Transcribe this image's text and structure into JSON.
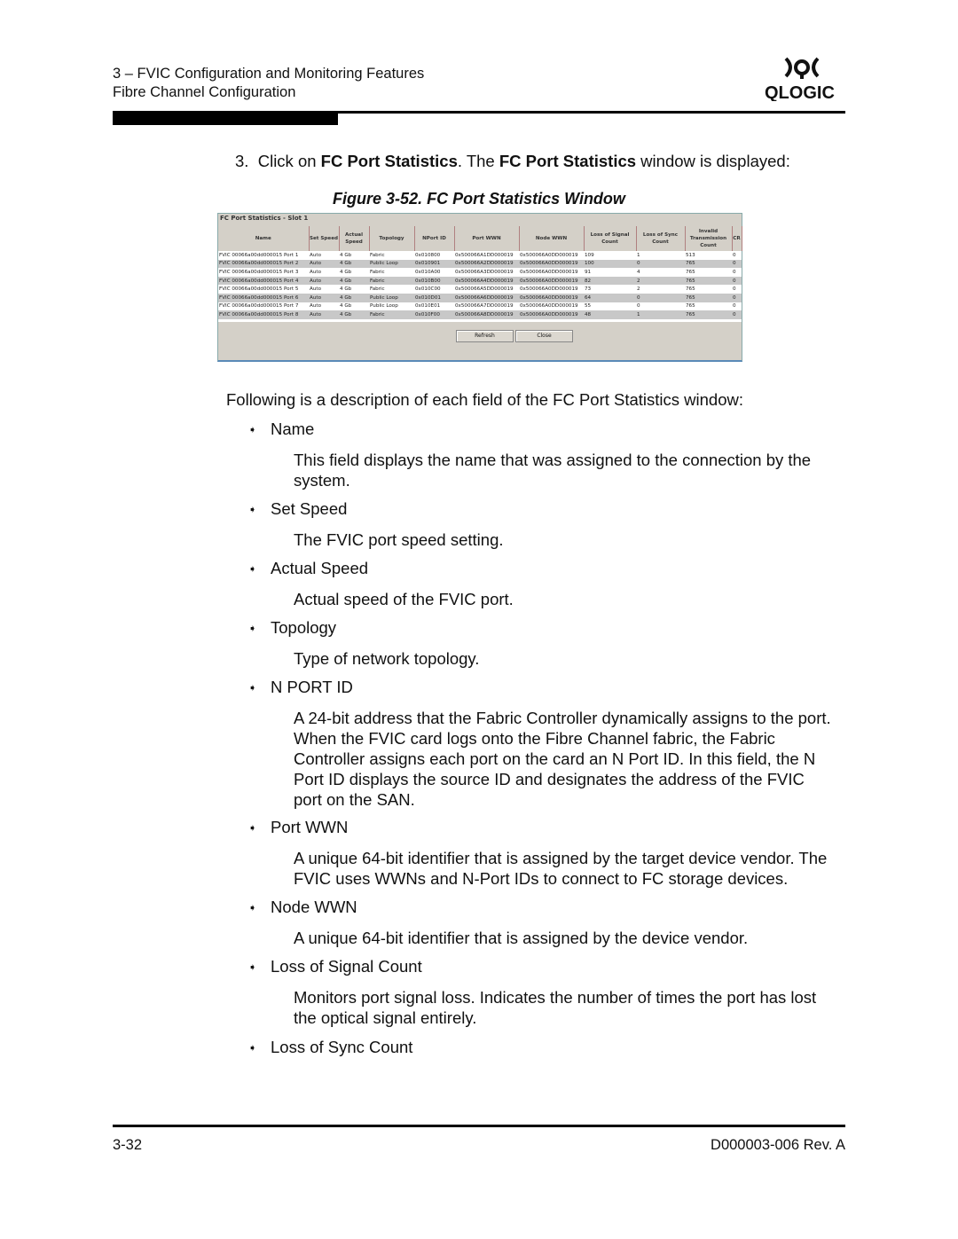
{
  "header": {
    "chapter": "3 – FVIC Configuration and Monitoring Features",
    "section": "Fibre Channel Configuration",
    "logo_text": "QLOGIC"
  },
  "intro": {
    "num": "3.",
    "pre": "Click on ",
    "b1": "FC Port Statistics",
    "mid": ". The ",
    "b2": "FC Port Statistics",
    "post": " window is displayed:"
  },
  "figure_caption": "Figure 3-52. FC Port Statistics Window",
  "window": {
    "title": "FC Port Statistics - Slot 1",
    "columns": [
      "Name",
      "Set Speed",
      "Actual Speed",
      "Topology",
      "NPort ID",
      "Port WWN",
      "Node WWN",
      "Loss of Signal Count",
      "Loss of Sync Count",
      "Invalid Transmission Count",
      "CR"
    ],
    "rows": [
      [
        "FVIC 00066a00dd000015 Port 1",
        "Auto",
        "4 Gb",
        "Fabric",
        "0x010800",
        "0x500066A1DD000019",
        "0x500066A0DD000019",
        "109",
        "1",
        "513",
        "0"
      ],
      [
        "FVIC 00066a00dd000015 Port 2",
        "Auto",
        "4 Gb",
        "Public Loop",
        "0x010901",
        "0x500066A2DD000019",
        "0x500066A0DD000019",
        "100",
        "0",
        "765",
        "0"
      ],
      [
        "FVIC 00066a00dd000015 Port 3",
        "Auto",
        "4 Gb",
        "Fabric",
        "0x010A00",
        "0x500066A3DD000019",
        "0x500066A0DD000019",
        "91",
        "4",
        "765",
        "0"
      ],
      [
        "FVIC 00066a00dd000015 Port 4",
        "Auto",
        "4 Gb",
        "Fabric",
        "0x010B00",
        "0x500066A4DD000019",
        "0x500066A0DD000019",
        "82",
        "2",
        "765",
        "0"
      ],
      [
        "FVIC 00066a00dd000015 Port 5",
        "Auto",
        "4 Gb",
        "Fabric",
        "0x010C00",
        "0x500066A5DD000019",
        "0x500066A0DD000019",
        "73",
        "2",
        "765",
        "0"
      ],
      [
        "FVIC 00066a00dd000015 Port 6",
        "Auto",
        "4 Gb",
        "Public Loop",
        "0x010D01",
        "0x500066A6DD000019",
        "0x500066A0DD000019",
        "64",
        "0",
        "765",
        "0"
      ],
      [
        "FVIC 00066a00dd000015 Port 7",
        "Auto",
        "4 Gb",
        "Public Loop",
        "0x010E01",
        "0x500066A7DD000019",
        "0x500066A0DD000019",
        "55",
        "0",
        "765",
        "0"
      ],
      [
        "FVIC 00066a00dd000015 Port 8",
        "Auto",
        "4 Gb",
        "Fabric",
        "0x010F00",
        "0x500066A8DD000019",
        "0x500066A0DD000019",
        "48",
        "1",
        "765",
        "0"
      ]
    ],
    "refresh_label": "Refresh",
    "close_label": "Close"
  },
  "following": "Following is a description of each field of the FC Port Statistics window:",
  "fields": [
    {
      "label": "Name",
      "desc": [
        "This field displays the name that was assigned to the connection by the",
        "system."
      ]
    },
    {
      "label": "Set Speed",
      "desc": [
        "The FVIC port speed setting."
      ]
    },
    {
      "label": "Actual Speed",
      "desc": [
        "Actual speed of the FVIC port."
      ]
    },
    {
      "label": "Topology",
      "desc": [
        "Type of network topology."
      ]
    },
    {
      "label": "N PORT ID",
      "desc": [
        "A 24-bit address that the Fabric Controller dynamically assigns to the port.",
        "When the FVIC card logs onto the Fibre Channel fabric, the Fabric",
        "Controller assigns each port on the card an N Port ID. In this field, the N",
        "Port ID displays the source ID and designates the address of the FVIC",
        "port on the SAN."
      ]
    },
    {
      "label": "Port WWN",
      "desc": [
        "A unique 64-bit identifier that is assigned by the target device vendor. The",
        "FVIC uses WWNs and N-Port IDs to connect to FC storage devices."
      ]
    },
    {
      "label": "Node WWN",
      "desc": [
        "A unique 64-bit identifier that is assigned by the device vendor."
      ]
    },
    {
      "label": "Loss of Signal Count",
      "desc": [
        "Monitors port signal loss. Indicates the number of times the port has lost",
        "the optical signal entirely."
      ]
    },
    {
      "label": "Loss of Sync Count",
      "desc": []
    }
  ],
  "footer": {
    "page": "3-32",
    "doc": "D000003-006 Rev. A"
  }
}
